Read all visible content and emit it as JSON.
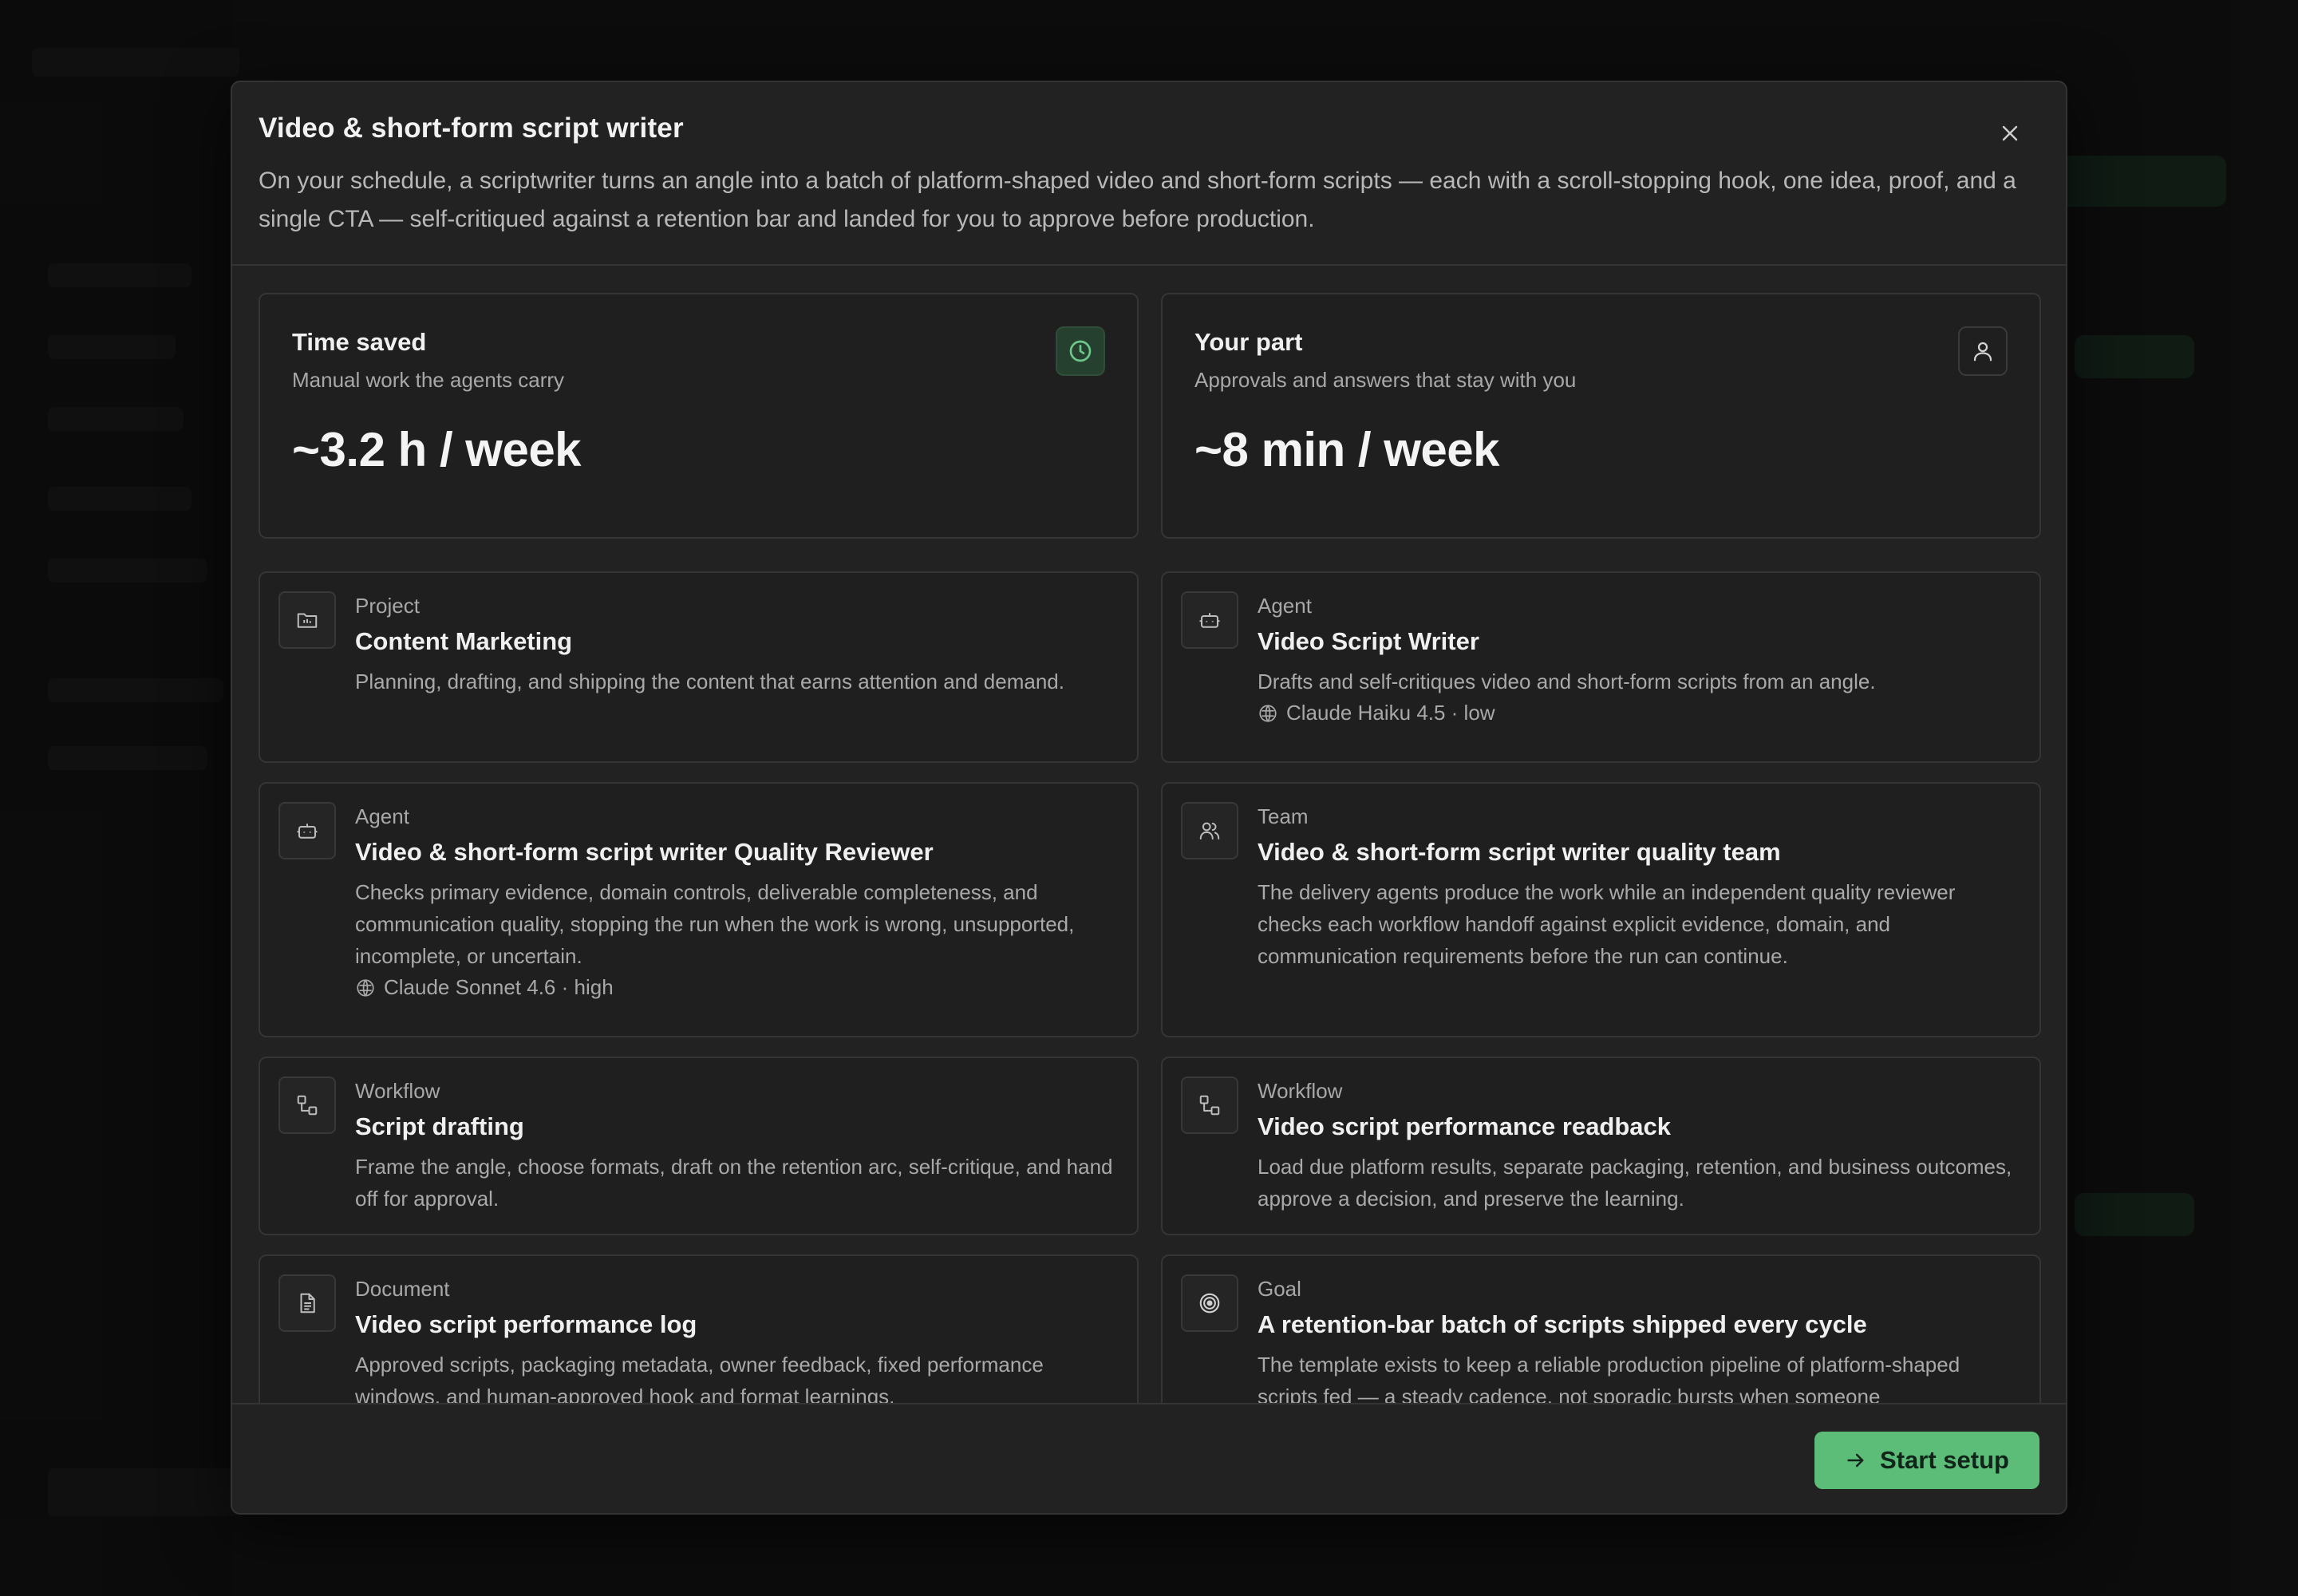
{
  "modal": {
    "title": "Video & short-form script writer",
    "description": "On your schedule, a scriptwriter turns an angle into a batch of platform-shaped video and short-form scripts — each with a scroll-stopping hook, one idea, proof, and a single CTA — self-critiqued against a retention bar and landed for you to approve before production.",
    "close_icon": "close-icon"
  },
  "stats": [
    {
      "title": "Time saved",
      "subtitle": "Manual work the agents carry",
      "value": "~3.2 h / week",
      "icon": "clock-icon"
    },
    {
      "title": "Your part",
      "subtitle": "Approvals and answers that stay with you",
      "value": "~8 min / week",
      "icon": "user-icon"
    }
  ],
  "items": [
    {
      "kind": "Project",
      "title": "Content Marketing",
      "description": "Planning, drafting, and shipping the content that earns attention and demand.",
      "icon": "folder-icon",
      "meta": ""
    },
    {
      "kind": "Agent",
      "title": "Video Script Writer",
      "description": "Drafts and self-critiques video and short-form scripts from an angle.",
      "icon": "bot-icon",
      "meta": "Claude Haiku 4.5 · low"
    },
    {
      "kind": "Agent",
      "title": "Video & short-form script writer Quality Reviewer",
      "description": "Checks primary evidence, domain controls, deliverable completeness, and communication quality, stopping the run when the work is wrong, unsupported, incomplete, or uncertain.",
      "icon": "bot-icon",
      "meta": "Claude Sonnet 4.6 · high"
    },
    {
      "kind": "Team",
      "title": "Video & short-form script writer quality team",
      "description": "The delivery agents produce the work while an independent quality reviewer checks each workflow handoff against explicit evidence, domain, and communication requirements before the run can continue.",
      "icon": "users-icon",
      "meta": ""
    },
    {
      "kind": "Workflow",
      "title": "Script drafting",
      "description": "Frame the angle, choose formats, draft on the retention arc, self-critique, and hand off for approval.",
      "icon": "workflow-icon",
      "meta": ""
    },
    {
      "kind": "Workflow",
      "title": "Video script performance readback",
      "description": "Load due platform results, separate packaging, retention, and business outcomes, approve a decision, and preserve the learning.",
      "icon": "workflow-icon",
      "meta": ""
    },
    {
      "kind": "Document",
      "title": "Video script performance log",
      "description": "Approved scripts, packaging metadata, owner feedback, fixed performance windows, and human-approved hook and format learnings.",
      "icon": "document-icon",
      "meta": ""
    },
    {
      "kind": "Goal",
      "title": "A retention-bar batch of scripts shipped every cycle",
      "description": "The template exists to keep a reliable production pipeline of platform-shaped scripts fed — a steady cadence, not sporadic bursts when someone",
      "icon": "target-icon",
      "meta": ""
    }
  ],
  "footer": {
    "start_label": "Start setup",
    "start_icon": "arrow-right-icon"
  },
  "colors": {
    "accent": "#5bbd78",
    "modal_bg": "#222222",
    "card_bg": "#1f1f1f",
    "border": "#353535"
  }
}
